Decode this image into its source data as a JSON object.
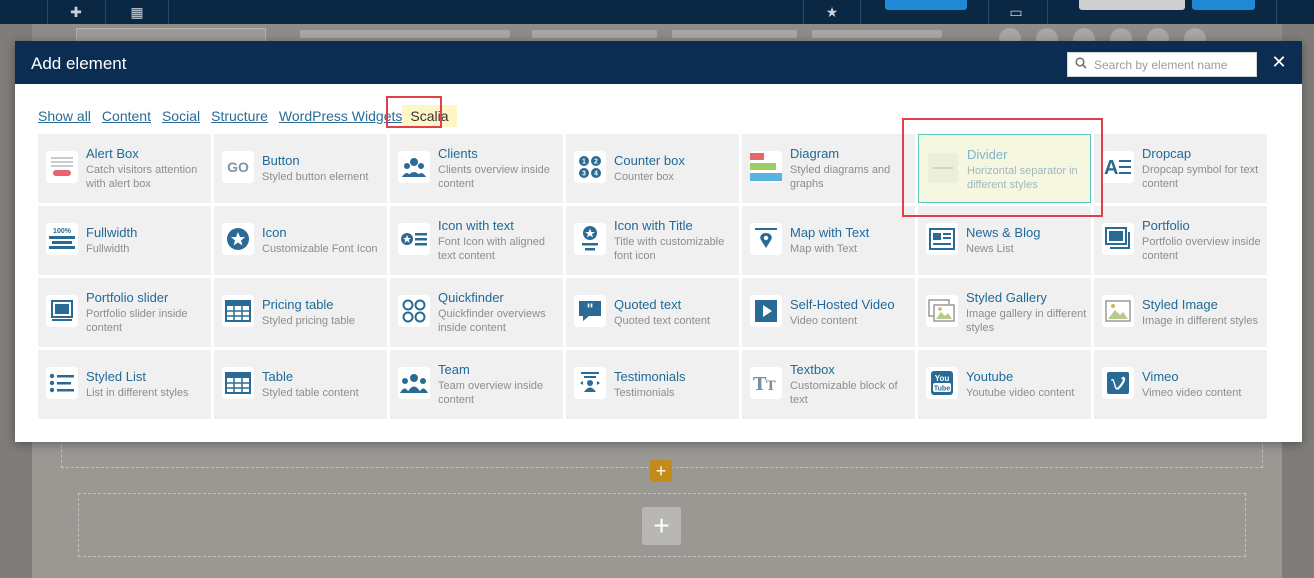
{
  "modal": {
    "title": "Add element",
    "search_placeholder": "Search by element name",
    "close_glyph": "✕"
  },
  "filters": [
    {
      "label": "Show all",
      "active": false
    },
    {
      "label": "Content",
      "active": false
    },
    {
      "label": "Social",
      "active": false
    },
    {
      "label": "Structure",
      "active": false
    },
    {
      "label": "WordPress Widgets",
      "active": false
    },
    {
      "label": "Scalia",
      "active": true
    }
  ],
  "elements": [
    {
      "title": "Alert Box",
      "desc": "Catch visitors attention with alert box",
      "icon": "alert-box-icon"
    },
    {
      "title": "Button",
      "desc": "Styled button element",
      "icon": "button-go-icon"
    },
    {
      "title": "Clients",
      "desc": "Clients overview inside content",
      "icon": "clients-icon"
    },
    {
      "title": "Counter box",
      "desc": "Counter box",
      "icon": "counter-icon"
    },
    {
      "title": "Diagram",
      "desc": "Styled diagrams and graphs",
      "icon": "diagram-icon"
    },
    {
      "title": "Divider",
      "desc": "Horizontal separator in different styles",
      "icon": "divider-icon",
      "highlight": true
    },
    {
      "title": "Dropcap",
      "desc": "Dropcap symbol for text content",
      "icon": "dropcap-icon"
    },
    {
      "title": "Fullwidth",
      "desc": "Fullwidth",
      "icon": "fullwidth-icon"
    },
    {
      "title": "Icon",
      "desc": "Customizable Font Icon",
      "icon": "star-icon"
    },
    {
      "title": "Icon with text",
      "desc": "Font Icon with aligned text content",
      "icon": "icon-with-text-icon"
    },
    {
      "title": "Icon with Title",
      "desc": "Title with customizable font icon",
      "icon": "icon-with-title-icon"
    },
    {
      "title": "Map with Text",
      "desc": "Map with Text",
      "icon": "map-pin-icon"
    },
    {
      "title": "News & Blog",
      "desc": "News List",
      "icon": "news-icon"
    },
    {
      "title": "Portfolio",
      "desc": "Portfolio overview inside content",
      "icon": "portfolio-icon"
    },
    {
      "title": "Portfolio slider",
      "desc": "Portfolio slider inside content",
      "icon": "portfolio-slider-icon"
    },
    {
      "title": "Pricing table",
      "desc": "Styled pricing table",
      "icon": "pricing-table-icon"
    },
    {
      "title": "Quickfinder",
      "desc": "Quickfinder overviews inside content",
      "icon": "quickfinder-icon"
    },
    {
      "title": "Quoted text",
      "desc": "Quoted text content",
      "icon": "quote-icon"
    },
    {
      "title": "Self-Hosted Video",
      "desc": "Video content",
      "icon": "video-play-icon"
    },
    {
      "title": "Styled Gallery",
      "desc": "Image gallery in different styles",
      "icon": "gallery-icon"
    },
    {
      "title": "Styled Image",
      "desc": "Image in different styles",
      "icon": "image-icon"
    },
    {
      "title": "Styled List",
      "desc": "List in different styles",
      "icon": "list-icon"
    },
    {
      "title": "Table",
      "desc": "Styled table content",
      "icon": "table-icon"
    },
    {
      "title": "Team",
      "desc": "Team overview inside content",
      "icon": "team-icon"
    },
    {
      "title": "Testimonials",
      "desc": "Testimonials",
      "icon": "testimonials-icon"
    },
    {
      "title": "Textbox",
      "desc": "Customizable block of text",
      "icon": "textbox-icon"
    },
    {
      "title": "Youtube",
      "desc": "Youtube video content",
      "icon": "youtube-icon"
    },
    {
      "title": "Vimeo",
      "desc": "Vimeo video content",
      "icon": "vimeo-icon"
    }
  ],
  "colors": {
    "header": "#0b2d52",
    "accent": "#1f6a98",
    "highlight_border": "#e0404a",
    "active_filter_bg": "#fff6c8"
  }
}
